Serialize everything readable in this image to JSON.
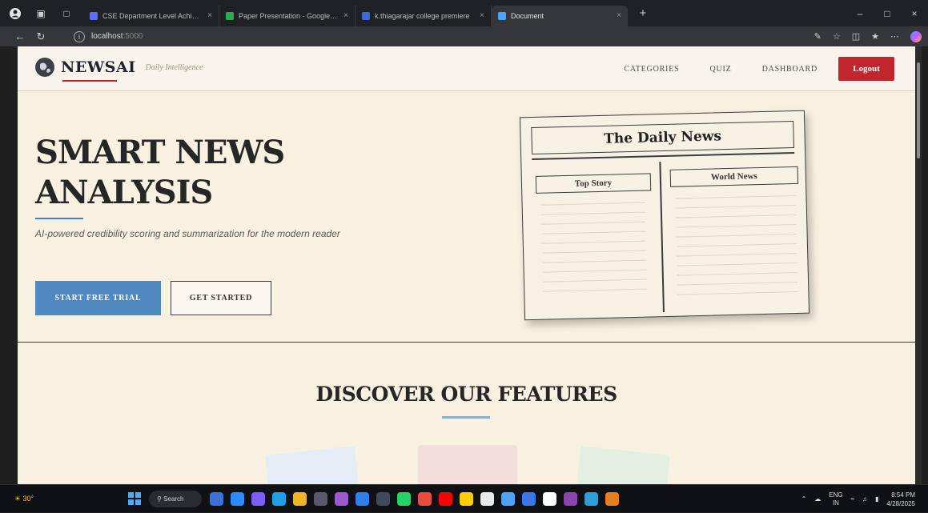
{
  "browser": {
    "tabs": [
      {
        "label": "CSE Department Level Achievem",
        "color": "#5b6cff"
      },
      {
        "label": "Paper Presentation - Google Dri",
        "color": "#2fa84f"
      },
      {
        "label": "k.thiagarajar college premiere",
        "color": "#3d6bd6"
      },
      {
        "label": "Document",
        "color": "#4aa3ff"
      }
    ],
    "url_host": "localhost",
    "url_port": ":5000",
    "new_tab": "+"
  },
  "site": {
    "brand": "NEWSAI",
    "tagline": "Daily Intelligence",
    "nav": [
      "CATEGORIES",
      "QUIZ",
      "DASHBOARD"
    ],
    "logout_label": "Logout"
  },
  "hero": {
    "title_line1": "SMART NEWS",
    "title_line2": "ANALYSIS",
    "subtitle": "AI-powered credibility scoring and summarization for the modern reader",
    "primary_button": "START FREE TRIAL",
    "secondary_button": "GET STARTED"
  },
  "newspaper": {
    "masthead": "The Daily News",
    "left_column": "Top Story",
    "right_column": "World News"
  },
  "features": {
    "title": "DISCOVER OUR FEATURES"
  },
  "taskbar": {
    "weather": "30°",
    "search_label": "Search",
    "lang_top": "ENG",
    "lang_bottom": "IN",
    "time": "8:54 PM",
    "date": "4/28/2025"
  },
  "colors": {
    "accent_red": "#c0262c",
    "accent_blue": "#4f89c0",
    "page_bg": "#f8f0e1"
  }
}
